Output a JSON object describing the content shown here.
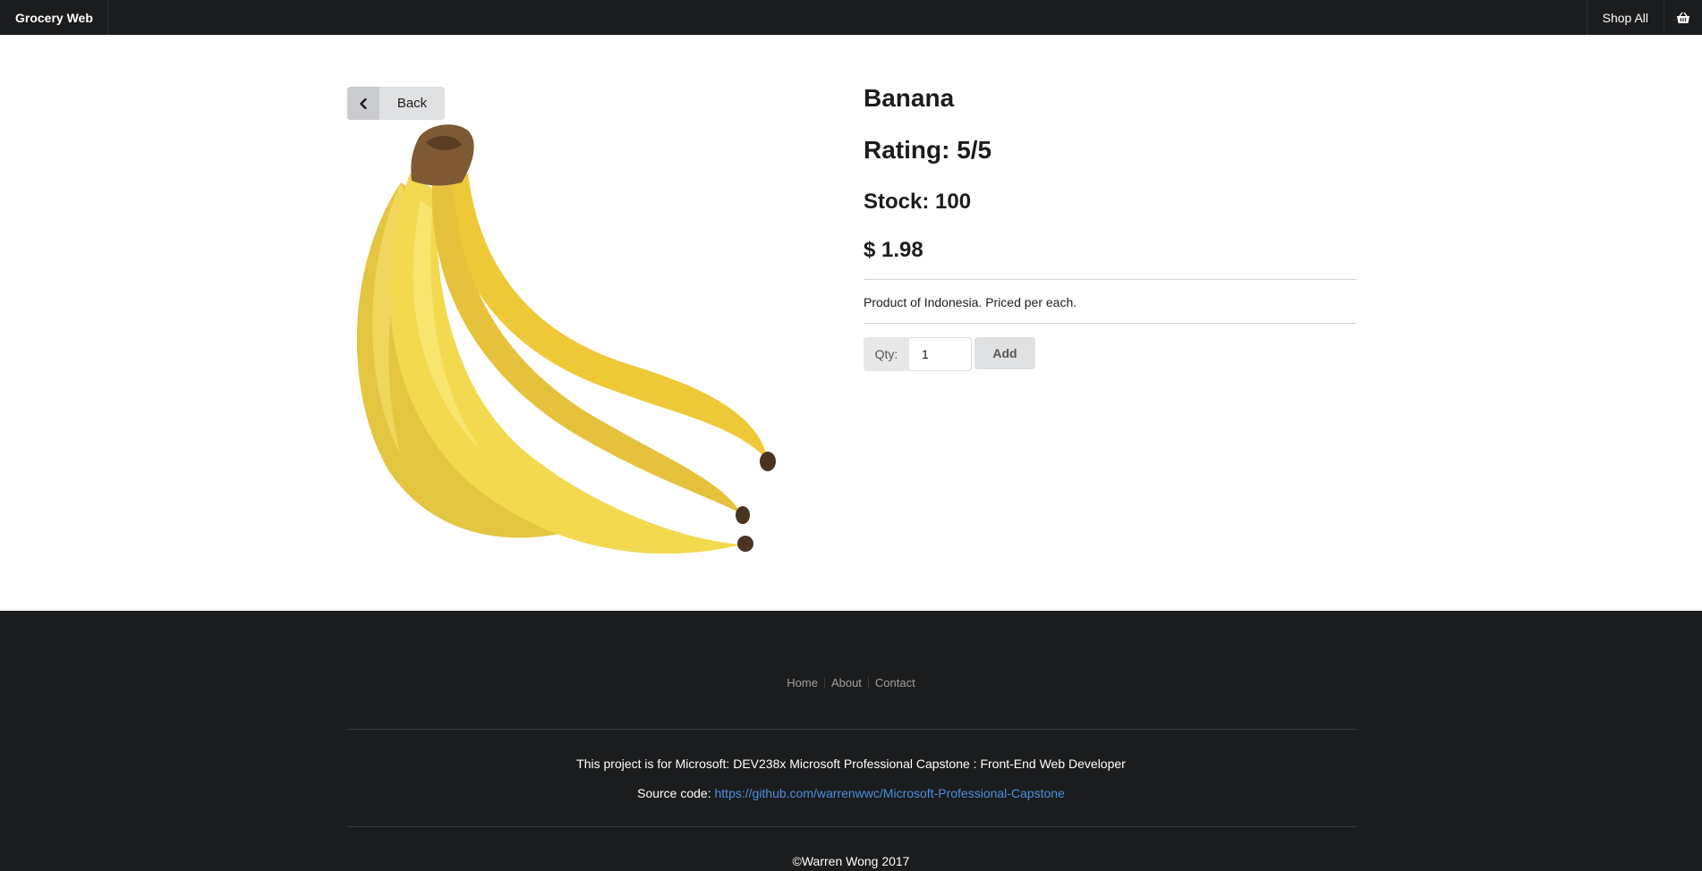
{
  "nav": {
    "brand": "Grocery Web",
    "shop_all": "Shop All",
    "cart_icon": "cart-icon"
  },
  "back_button": {
    "label": "Back",
    "icon": "chevron-left-icon"
  },
  "product": {
    "name": "Banana",
    "rating": "Rating: 5/5",
    "stock": "Stock: 100",
    "price": "$ 1.98",
    "description": "Product of Indonesia. Priced per each.",
    "image": "banana-image"
  },
  "cart_form": {
    "qty_label": "Qty:",
    "qty_value": "1",
    "add_label": "Add"
  },
  "footer": {
    "links": [
      "Home",
      "About",
      "Contact"
    ],
    "project_text": "This project is for Microsoft: DEV238x Microsoft Professional Capstone : Front-End Web Developer",
    "source_label": "Source code:",
    "source_url": "https://github.com/warrenwwc/Microsoft-Professional-Capstone",
    "copyright": "©Warren Wong 2017"
  },
  "colors": {
    "nav_bg": "#1b1c1d",
    "link_blue": "#4d8fe0",
    "button_bg": "#e0e1e2"
  }
}
